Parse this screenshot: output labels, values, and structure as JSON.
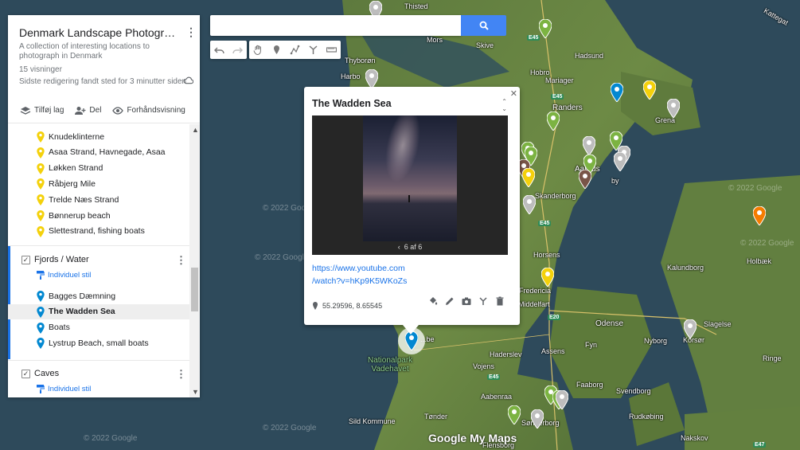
{
  "map": {
    "title": "Denmark Landscape Photography...",
    "description": "A collection of interesting locations to photograph in Denmark",
    "views": "15 visninger",
    "last_edit": "Sidste redigering fandt sted for 3 minutter siden",
    "actions": {
      "add_layer": "Tilføj lag",
      "share": "Del",
      "preview": "Forhåndsvisning"
    }
  },
  "layers": {
    "beaches": {
      "items": [
        "Knudeklinterne",
        "Asaa Strand, Havnegade, Asaa",
        "Løkken Strand",
        "Råbjerg Mile",
        "Trelde Næs Strand",
        "Bønnerup beach",
        "Slettestrand, fishing boats"
      ],
      "color": "#f4d10b"
    },
    "fjords": {
      "name": "Fjords / Water",
      "style": "Individuel stil",
      "items": [
        "Bagges Dæmning",
        "The Wadden Sea",
        "Boats",
        "Lystrup Beach, small boats"
      ],
      "selected": "The Wadden Sea",
      "color": "#0288d1"
    },
    "caves": {
      "name": "Caves",
      "style": "Individuel stil"
    }
  },
  "search": {
    "value": "",
    "placeholder": ""
  },
  "info_window": {
    "title": "The Wadden Sea",
    "photo_counter": "6 af 6",
    "link_line1": "https://www.youtube.com",
    "link_line2": "/watch?v=hKp9K5WKoZs",
    "coordinates": "55.29596, 8.65545"
  },
  "map_labels": {
    "thisted": "Thisted",
    "mors": "Mors",
    "skive": "Skive",
    "hobro": "Hobro",
    "hadsund": "Hadsund",
    "thyboron": "Thyborøn",
    "harbo": "Harbo",
    "randers": "Randers",
    "mariager": "Mariager",
    "grena": "Grena",
    "aarhus": "Aarhus",
    "skanderborg": "Skanderborg",
    "horsens": "Horsens",
    "fredericia": "Fredericia",
    "middelfart": "Middelfart",
    "kalundborg": "Kalundborg",
    "holbaek": "Holbæk",
    "slagelse": "Slagelse",
    "korsor": "Korsør",
    "nyborg": "Nyborg",
    "odense": "Odense",
    "assens": "Assens",
    "fyn": "Fyn",
    "haderslev": "Haderslev",
    "vojens": "Vojens",
    "aabenraa": "Aabenraa",
    "faaborg": "Faaborg",
    "svendborg": "Svendborg",
    "rudkobing": "Rudkøbing",
    "tonder": "Tønder",
    "sild": "Sild Kommune",
    "sonderborg": "Sønderborg",
    "flensborg": "Flensborg",
    "nakskov": "Nakskov",
    "ringe": "Ringe",
    "vadehavet": "Nationalpark\nVadehavet",
    "dalby": "by",
    "kattegat": "Kattegat",
    "skjern": "...be",
    "watermark1": "© 2022 Google",
    "watermark2": "© 2022 Google",
    "watermark3": "© 2022 Google",
    "watermark4": "© 2022 Google",
    "watermark5": "© 2022 Google",
    "watermark6": "© 2022 Google",
    "e45a": "E45",
    "e45b": "E45",
    "e45c": "E45",
    "e20": "E20",
    "e45d": "E45",
    "e47": "E47",
    "google_my_maps": "Google My Maps"
  },
  "colors": {
    "yellow": "#f4d10b",
    "green": "#7cb342",
    "blue": "#0288d1",
    "grey": "#bdbdbd",
    "brown": "#795548",
    "orange": "#f57c00",
    "accent": "#1a73e8"
  }
}
